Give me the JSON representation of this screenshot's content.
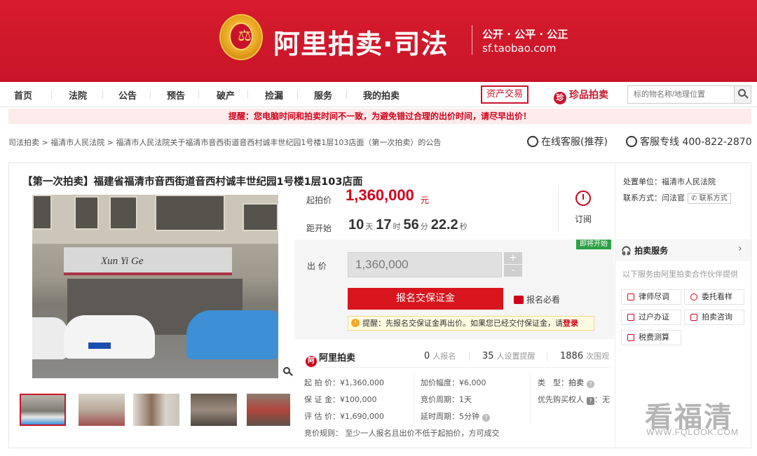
{
  "header": {
    "brand_title": "阿里拍卖·司法",
    "motto": "公开 · 公平 · 公正",
    "url": "sf.taobao.com"
  },
  "nav": {
    "items": [
      "首页",
      "法院",
      "公告",
      "预告",
      "破产",
      "捡漏",
      "服务",
      "我的拍卖"
    ],
    "asset_trade": "资产交易",
    "zhenpin": "珍品拍卖",
    "search_placeholder": "标的物名称/地理位置"
  },
  "warning": "提醒：您电脑时间和拍卖时间不一致，为避免错过合理的出价时间，请尽早出价！",
  "breadcrumb": {
    "items": [
      "司法拍卖",
      "福清市人民法院",
      "福清市人民法院关于福清市音西街道音西村诚丰世纪园1号楼1层103店面（第一次拍卖）的公告"
    ]
  },
  "customer_service": {
    "online": "在线客服(推荐)",
    "hotline": "客服专线 400-822-2870"
  },
  "lot": {
    "title": "【第一次拍卖】福建省福清市音西街道音西村诚丰世纪园1号楼1层103店面",
    "photo_sign_text": "Xun Yi Ge",
    "start_price_label": "起拍价",
    "start_price": "1,360,000",
    "currency": "元",
    "countdown_label": "距开始",
    "countdown": {
      "days": "10",
      "hours": "17",
      "minutes": "56",
      "seconds": "22.2"
    },
    "countdown_units": {
      "days": "天",
      "hours": "时",
      "minutes": "分",
      "seconds": "秒"
    },
    "remind_label": "订阅",
    "soon_badge": "即将开始",
    "bid_label": "出 价",
    "bid_value": "1,360,000",
    "plus": "+",
    "minus": "-",
    "signup_button": "报名交保证金",
    "must_read": "报名必看",
    "tip": "提醒：先报名交保证金再出价。如果您已经交付保证金，请",
    "tip_link": "登录"
  },
  "stats": {
    "brand": "阿里拍卖",
    "signups": "0",
    "signups_label": "人报名",
    "reminders": "35",
    "reminders_label": "人设置提醒",
    "views": "1886",
    "views_label": "次围观"
  },
  "details": {
    "start_price": "起 拍 价：¥1,360,000",
    "deposit": "保 证 金：¥100,000",
    "appraisal": "评 估 价：¥1,690,000",
    "increment": "加价幅度：¥6,000",
    "auction_period": "竞价周期：1天",
    "extension": "延时周期：5分钟",
    "type_label": "类　型：",
    "type_value": "拍卖",
    "priority_label": "优先购买权人",
    "priority_badge": "?",
    "priority_value": "：无",
    "rule": "竞价规则：  至少一人报名且出价不低于起拍价，方可成交"
  },
  "sidebar": {
    "court": "处置单位：福清市人民法院",
    "contact_label": "联系方式：闫法官",
    "contact_button": "联系方式",
    "service_title": "拍卖服务",
    "service_desc": "以下服务由阿里拍卖合作伙伴提供",
    "services": [
      "律师尽调",
      "委托看样",
      "过户办证",
      "拍卖咨询",
      "税费测算"
    ]
  },
  "watermark": {
    "text": "看福清",
    "url": "WWW.FQLOOK.COM"
  }
}
